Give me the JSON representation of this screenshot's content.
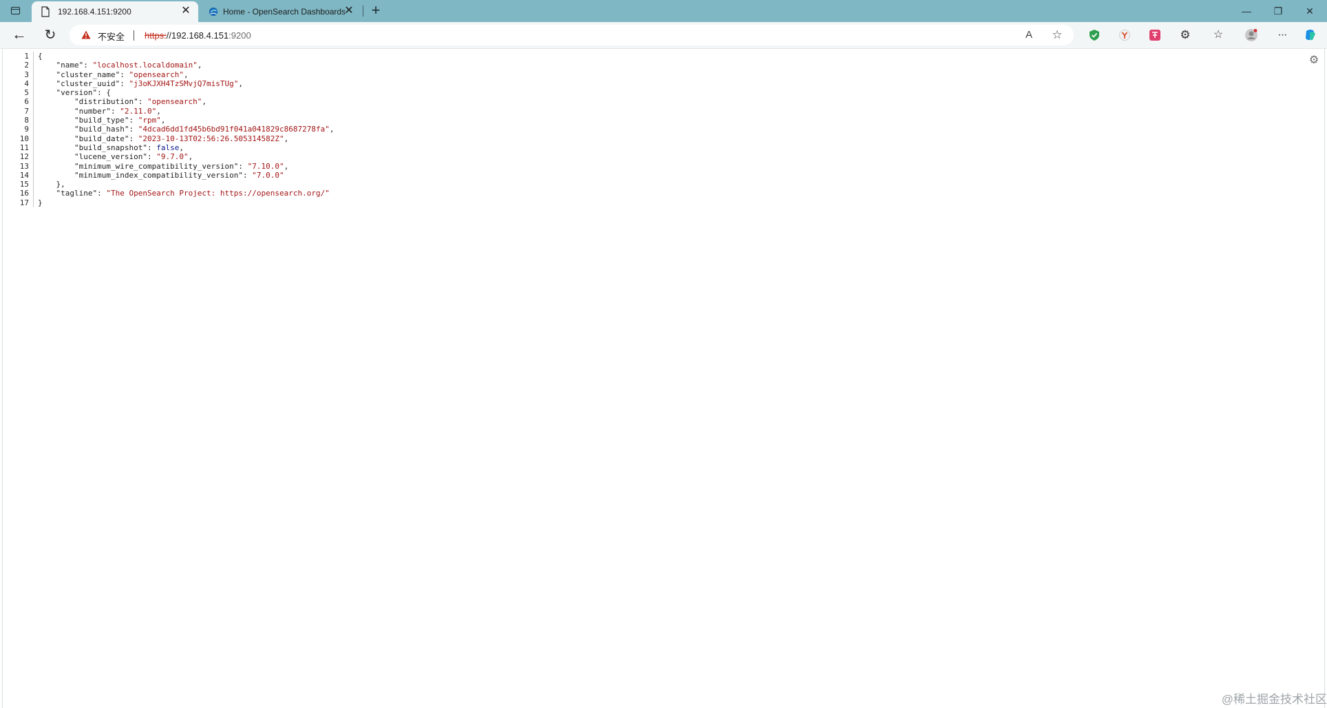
{
  "window_controls": {
    "minimize": "—",
    "maximize": "❐",
    "close": "✕"
  },
  "tabs": [
    {
      "title": "192.168.4.151:9200",
      "active": true,
      "close": "✕"
    },
    {
      "title": "Home - OpenSearch Dashboards",
      "active": false,
      "close": "✕"
    }
  ],
  "new_tab_label": "+",
  "toolbar": {
    "back": "←",
    "reload": "↻",
    "security_label": "不安全",
    "url": {
      "scheme": "https:",
      "slashes": "//",
      "host": "192.168.4.151",
      "port": ":9200"
    },
    "read_aloud": "A",
    "favorite": "☆",
    "extensions": "⚙",
    "collections": "☆",
    "more": "···"
  },
  "json_lines": [
    {
      "n": "1",
      "html": "{"
    },
    {
      "n": "2",
      "html": "    <span class=\"k\">\"name\"</span>: <span class=\"s\">\"localhost.localdomain\"</span>,"
    },
    {
      "n": "3",
      "html": "    <span class=\"k\">\"cluster_name\"</span>: <span class=\"s\">\"opensearch\"</span>,"
    },
    {
      "n": "4",
      "html": "    <span class=\"k\">\"cluster_uuid\"</span>: <span class=\"s\">\"j3oKJXH4TzSMvjQ7misTUg\"</span>,"
    },
    {
      "n": "5",
      "html": "    <span class=\"k\">\"version\"</span>: {"
    },
    {
      "n": "6",
      "html": "        <span class=\"k\">\"distribution\"</span>: <span class=\"s\">\"opensearch\"</span>,"
    },
    {
      "n": "7",
      "html": "        <span class=\"k\">\"number\"</span>: <span class=\"s\">\"2.11.0\"</span>,"
    },
    {
      "n": "8",
      "html": "        <span class=\"k\">\"build_type\"</span>: <span class=\"s\">\"rpm\"</span>,"
    },
    {
      "n": "9",
      "html": "        <span class=\"k\">\"build_hash\"</span>: <span class=\"s\">\"4dcad6dd1fd45b6bd91f041a041829c8687278fa\"</span>,"
    },
    {
      "n": "10",
      "html": "        <span class=\"k\">\"build_date\"</span>: <span class=\"s\">\"2023-10-13T02:56:26.505314582Z\"</span>,"
    },
    {
      "n": "11",
      "html": "        <span class=\"k\">\"build_snapshot\"</span>: <span class=\"b\">false</span>,"
    },
    {
      "n": "12",
      "html": "        <span class=\"k\">\"lucene_version\"</span>: <span class=\"s\">\"9.7.0\"</span>,"
    },
    {
      "n": "13",
      "html": "        <span class=\"k\">\"minimum_wire_compatibility_version\"</span>: <span class=\"s\">\"7.10.0\"</span>,"
    },
    {
      "n": "14",
      "html": "        <span class=\"k\">\"minimum_index_compatibility_version\"</span>: <span class=\"s\">\"7.0.0\"</span>"
    },
    {
      "n": "15",
      "html": "    },"
    },
    {
      "n": "16",
      "html": "    <span class=\"k\">\"tagline\"</span>: <span class=\"s\">\"The OpenSearch Project: https://opensearch.org/\"</span>"
    },
    {
      "n": "17",
      "html": "}"
    }
  ],
  "content_settings": "⚙",
  "watermark": "@稀土掘金技术社区",
  "colors": {
    "tabstrip": "#7fb8c4",
    "toolbar": "#f3f6f7",
    "json_string": "#a31515",
    "json_bool": "#0d1b8c",
    "insecure_red": "#c42b1c"
  }
}
